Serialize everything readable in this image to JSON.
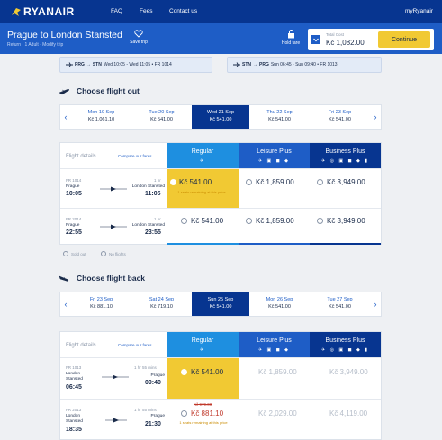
{
  "header": {
    "logo_text": "RYANAIR",
    "nav": [
      "FAQ",
      "Fees",
      "Contact us"
    ],
    "user": "myRyanair"
  },
  "trip": {
    "title": "Prague to London Stansted",
    "subtitle": "Return · 1 Adult · Modify trip",
    "save_label": "Save trip",
    "hold_label": "Hold fare",
    "total_label": "Total Cost",
    "total_value": "Kč 1,082.00",
    "continue_label": "Continue"
  },
  "summary": {
    "outbound": {
      "from": "PRG",
      "to": "STN",
      "details": "Wed 10:05 - Wed 11:05 • FR 1014"
    },
    "inbound": {
      "from": "STN",
      "to": "PRG",
      "details": "Sun 06:45 - Sun 09:40 • FR 1013"
    }
  },
  "outbound": {
    "title": "Choose flight out",
    "dates": [
      {
        "day": "Mon 19 Sep",
        "price": "Kč 1,061.10",
        "active": false
      },
      {
        "day": "Tue 20 Sep",
        "price": "Kč 541.00",
        "active": false
      },
      {
        "day": "Wed 21 Sep",
        "price": "Kč 541.00",
        "active": true
      },
      {
        "day": "Thu 22 Sep",
        "price": "Kč 541.00",
        "active": false
      },
      {
        "day": "Fri 23 Sep",
        "price": "Kč 541.00",
        "active": false
      }
    ],
    "flight_details_label": "Flight details",
    "compare_label": "Compare our fares",
    "fares": [
      "Regular",
      "Leisure Plus",
      "Business Plus"
    ],
    "fare_colors": [
      "#1e8fe0",
      "#1e5dc6",
      "#073590"
    ],
    "flights": [
      {
        "number": "FR 1014",
        "origin": "Prague",
        "dep": "10:05",
        "duration": "1 hr",
        "destination": "London Stansted",
        "arr": "11:05",
        "regular": "Kč 541.00",
        "seats": "1 seats remaining at this price",
        "leisure": "Kč 1,859.00",
        "business": "Kč 3,949.00"
      },
      {
        "number": "FR 2014",
        "origin": "Prague",
        "dep": "22:55",
        "duration": "1 hr",
        "destination": "London Stansted",
        "arr": "23:55",
        "regular": "Kč 541.00",
        "seats": "",
        "leisure": "Kč 1,859.00",
        "business": "Kč 3,949.00"
      }
    ],
    "legend": [
      "Sold out",
      "No flights"
    ]
  },
  "inbound": {
    "title": "Choose flight back",
    "dates": [
      {
        "day": "Fri 23 Sep",
        "price": "Kč 881.10",
        "active": false
      },
      {
        "day": "Sat 24 Sep",
        "price": "Kč 719.10",
        "active": false
      },
      {
        "day": "Sun 25 Sep",
        "price": "Kč 541.00",
        "active": true
      },
      {
        "day": "Mon 26 Sep",
        "price": "Kč 541.00",
        "active": false
      },
      {
        "day": "Tue 27 Sep",
        "price": "Kč 541.00",
        "active": false
      }
    ],
    "flight_details_label": "Flight details",
    "compare_label": "Compare our fares",
    "fares": [
      "Regular",
      "Leisure Plus",
      "Business Plus"
    ],
    "flights": [
      {
        "number": "FR 1013",
        "origin": "London Stansted",
        "dep": "06:45",
        "duration": "1 hr 55 mins",
        "destination": "Prague",
        "arr": "09:40",
        "regular": "Kč 541.00",
        "leisure": "Kč 1,859.00",
        "business": "Kč 3,949.00"
      },
      {
        "number": "FR 2013",
        "origin": "London Stansted",
        "dep": "18:35",
        "duration": "1 hr 55 mins",
        "destination": "Prague",
        "arr": "21:30",
        "regular_old": "Kč 979.00",
        "regular": "Kč 881.10",
        "seats": "1 seats remaining at this price",
        "leisure": "Kč 2,029.00",
        "business": "Kč 4,119.00"
      }
    ]
  },
  "colors": {
    "header": "#073590",
    "tripbar": "#1e5dc6",
    "accent": "#f1c933",
    "regular": "#1e8fe0"
  }
}
